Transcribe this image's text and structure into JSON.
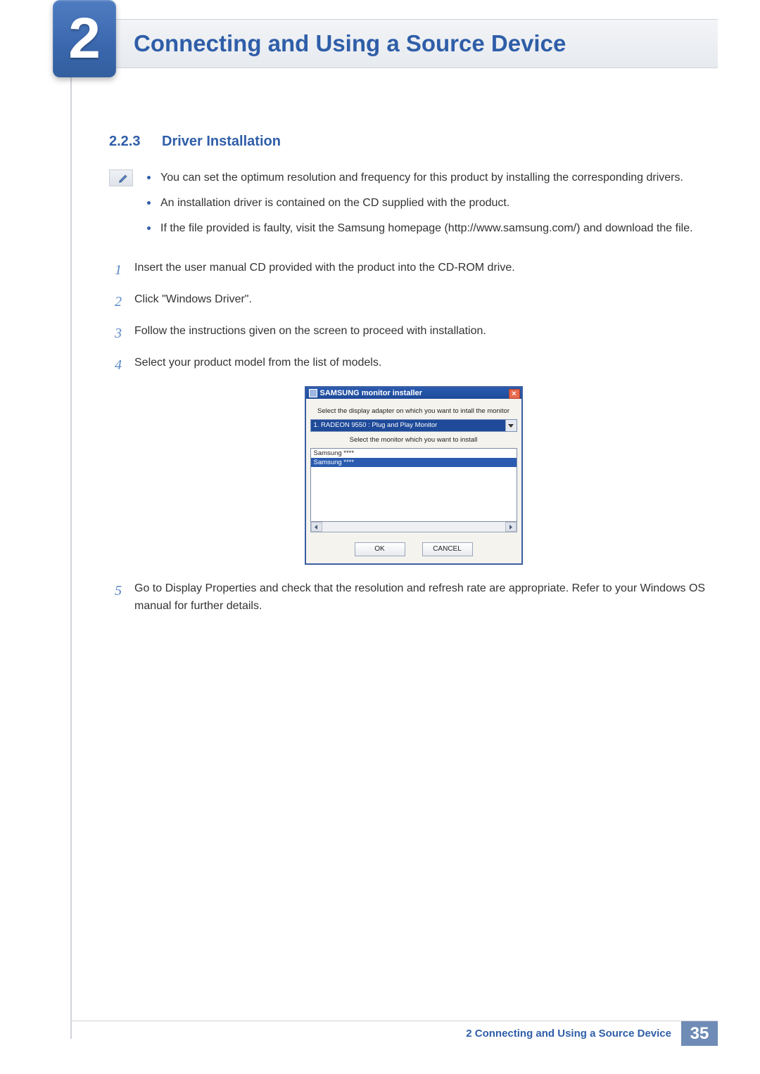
{
  "header": {
    "chapter_number": "2",
    "chapter_title": "Connecting and Using a Source Device"
  },
  "section": {
    "number": "2.2.3",
    "title": "Driver Installation"
  },
  "notes": [
    "You can set the optimum resolution and frequency for this product by installing the corresponding drivers.",
    "An installation driver is contained on the CD supplied with the product.",
    "If the file provided is faulty, visit the Samsung homepage (http://www.samsung.com/) and download the file."
  ],
  "steps": {
    "s1": {
      "n": "1",
      "t": "Insert the user manual CD provided with the product into the CD-ROM drive."
    },
    "s2": {
      "n": "2",
      "t": "Click \"Windows Driver\"."
    },
    "s3": {
      "n": "3",
      "t": "Follow the instructions given on the screen to proceed with installation."
    },
    "s4": {
      "n": "4",
      "t": "Select your product model from the list of models."
    },
    "s5": {
      "n": "5",
      "t": "Go to Display Properties and check that the resolution and refresh rate are appropriate. Refer to your Windows OS manual for further details."
    }
  },
  "dialog": {
    "title": "SAMSUNG monitor installer",
    "close": "×",
    "line1": "Select the display adapter on which you want to intall the monitor",
    "select_value": "1. RADEON 9550 : Plug and Play Monitor",
    "line2": "Select the monitor which you want to install",
    "list_item1": "Samsung ****",
    "list_item2": "Samsung ****",
    "ok": "OK",
    "cancel": "CANCEL"
  },
  "footer": {
    "text": "2 Connecting and Using a Source Device",
    "page": "35"
  }
}
